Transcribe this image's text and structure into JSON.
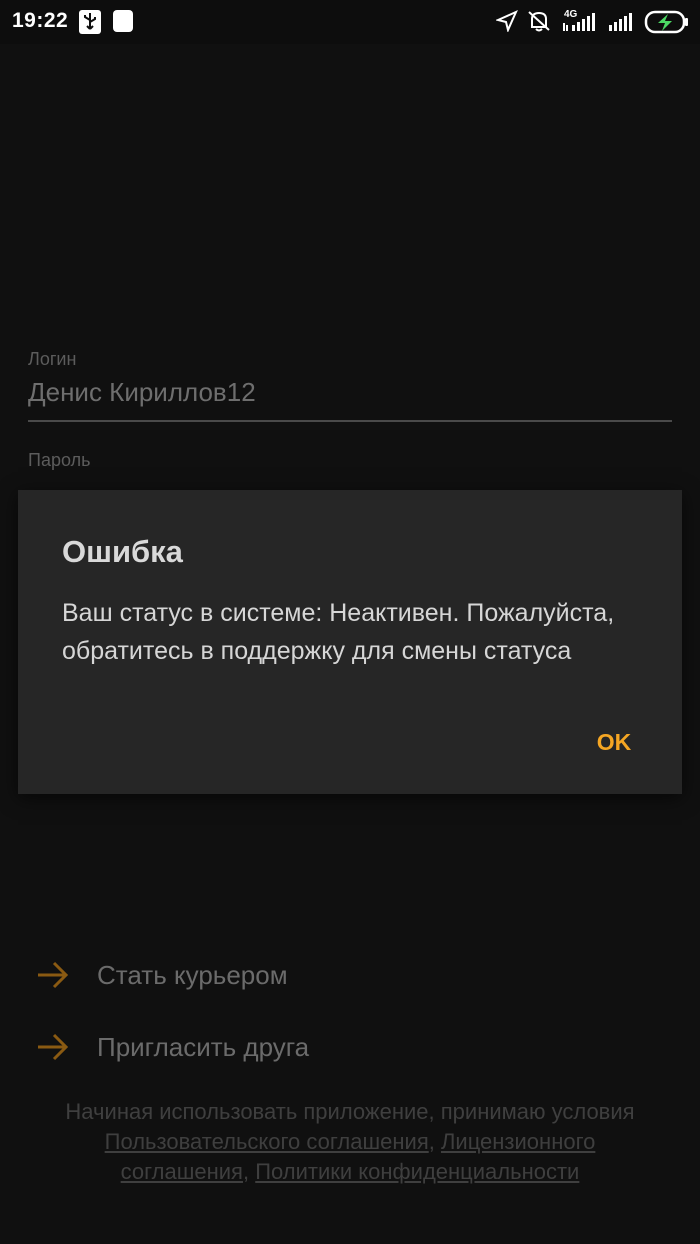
{
  "status_bar": {
    "time": "19:22",
    "network_type": "4G",
    "icons": [
      "usb-icon",
      "notification-square-icon",
      "location-arrow-icon",
      "mute-icon",
      "signal-icon",
      "signal-icon-2",
      "battery-charging-icon"
    ]
  },
  "form": {
    "login_label": "Логин",
    "login_value": "Денис Кириллов12",
    "password_label": "Пароль"
  },
  "dialog": {
    "title": "Ошибка",
    "message": "Ваш статус в системе: Неактивен. Пожалуйста, обратитесь в поддержку для смены статуса",
    "ok_label": "OK"
  },
  "actions": [
    {
      "label": "Стать курьером",
      "icon": "arrow-right-icon"
    },
    {
      "label": "Пригласить друга",
      "icon": "arrow-right-icon"
    }
  ],
  "legal": {
    "prefix": "Начиная использовать приложение, принимаю условия ",
    "link_user_agreement": "Пользовательского соглашения",
    "sep1": ", ",
    "link_license": "Лицензионного соглашения",
    "sep2": ", ",
    "link_privacy": "Политики конфиденциальности"
  },
  "colors": {
    "accent": "#f5a623",
    "arrow": "#8a5a12",
    "dialog_bg": "#262626",
    "screen_bg": "#101010"
  }
}
